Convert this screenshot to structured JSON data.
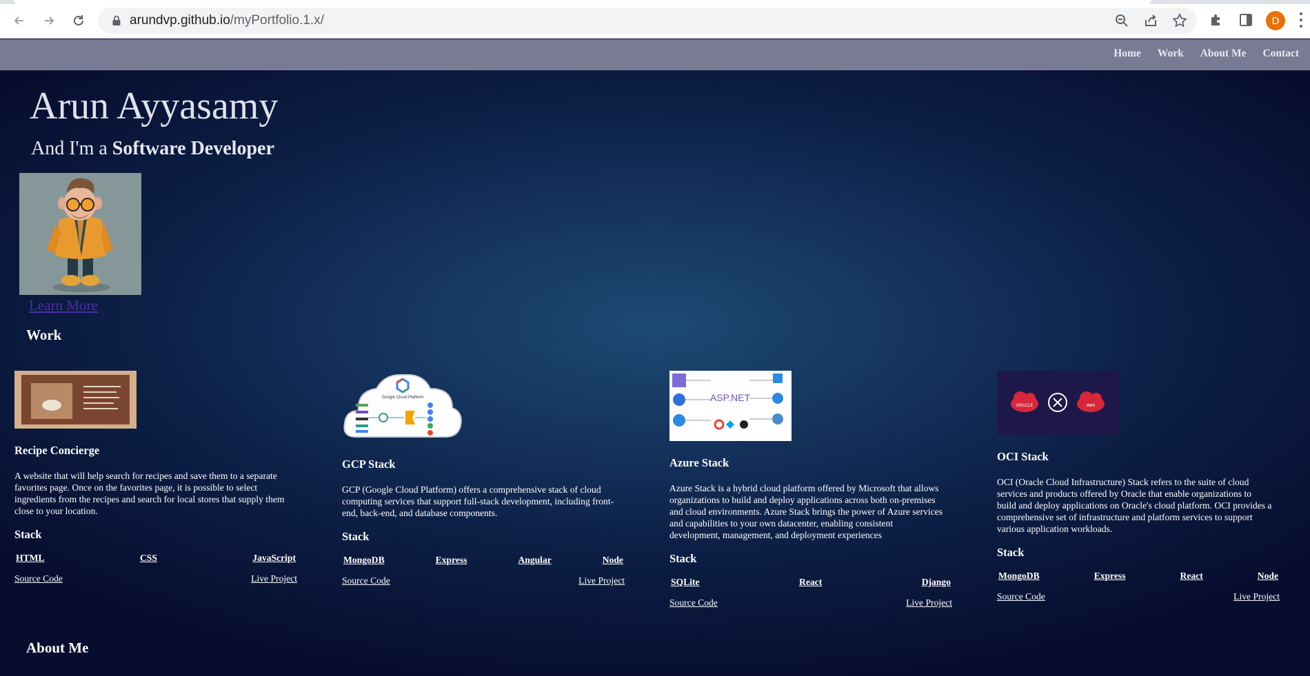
{
  "browser": {
    "url_domain": "arundvp.github.io",
    "url_path": "/myPortfolio.1.x/",
    "profile_initial": "D"
  },
  "nav": {
    "links": [
      "Home",
      "Work",
      "About Me",
      "Contact"
    ]
  },
  "hero": {
    "name": "Arun Ayyasamy",
    "tagline_prefix": "And I'm a ",
    "tagline_role": "Software Developer",
    "learn_more": "Learn More"
  },
  "sections": {
    "work": "Work",
    "about": "About Me"
  },
  "projects": [
    {
      "title": "Recipe Concierge",
      "description": "A website that will help search for recipes and save them to a separate favorites page. Once on the favorites page, it is possible to select ingredients from the recipes and search for local stores that supply them close to your location.",
      "stack_label": "Stack",
      "stack": [
        "HTML",
        "CSS",
        "JavaScript"
      ],
      "source": "Source Code",
      "live": "Live Project"
    },
    {
      "title": "GCP Stack",
      "description": "GCP (Google Cloud Platform) offers a comprehensive stack of cloud computing services that support full-stack development, including front-end, back-end, and database components.",
      "stack_label": "Stack",
      "stack": [
        "MongoDB",
        "Express",
        "Angular",
        "Node"
      ],
      "source": "Source Code",
      "live": "Live Project",
      "image_text": "Google Cloud Platform"
    },
    {
      "title": "Azure Stack",
      "description": "Azure Stack is a hybrid cloud platform offered by Microsoft that allows organizations to build and deploy applications across both on-premises and cloud environments. Azure Stack brings the power of Azure services and capabilities to your own datacenter, enabling consistent development, management, and deployment experiences",
      "stack_label": "Stack",
      "stack": [
        "SQLite",
        "React",
        "Django"
      ],
      "source": "Source Code",
      "live": "Live Project",
      "image_text": "ASP.NET"
    },
    {
      "title": "OCI Stack",
      "description": "OCI (Oracle Cloud Infrastructure) Stack refers to the suite of cloud services and products offered by Oracle that enable organizations to build and deploy applications on Oracle's cloud platform. OCI provides a comprehensive set of infrastructure and platform services to support various application workloads.",
      "stack_label": "Stack",
      "stack": [
        "MongoDB",
        "Express",
        "React",
        "Node"
      ],
      "source": "Source Code",
      "live": "Live Project",
      "image_text_left": "ORACLE",
      "image_text_right": "aws"
    }
  ],
  "colors": {
    "nav_bg": "#797b95",
    "page_bg": "#0a1230",
    "learn_more": "#4b2fa6",
    "profile": "#e8710a"
  }
}
